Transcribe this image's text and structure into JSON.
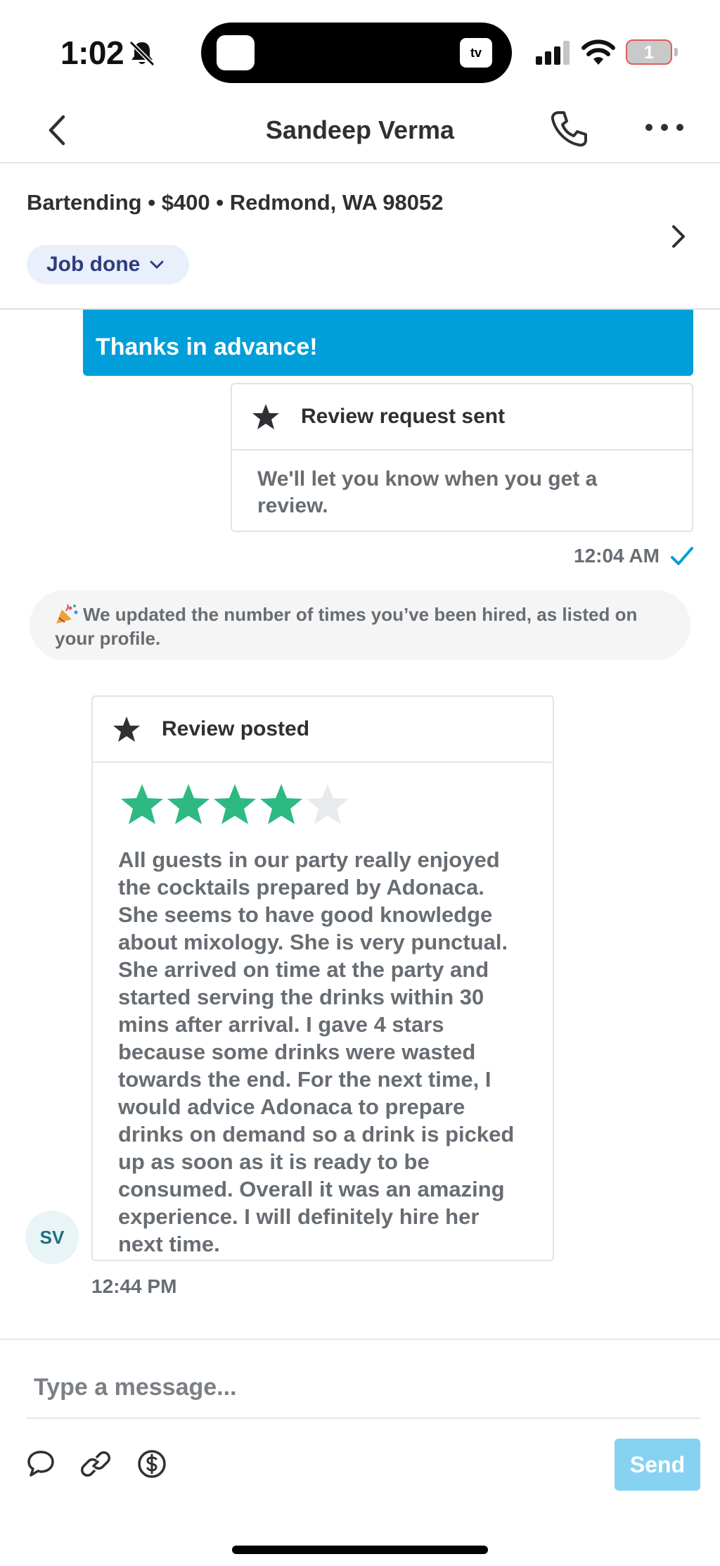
{
  "status_bar": {
    "time": "1:02",
    "island_tv_label": "tv",
    "battery_level": "1"
  },
  "header": {
    "title": "Sandeep Verma"
  },
  "job": {
    "summary": "Bartending • $400 • Redmond, WA 98052",
    "status": "Job done"
  },
  "messages": {
    "bubble_text": "Thanks in advance!",
    "review_request": {
      "title": "Review request sent",
      "body": "We'll let you know when you get a review.",
      "time": "12:04 AM"
    },
    "system_note": "We updated the number of times you’ve been hired, as listed on your profile.",
    "review_posted": {
      "title": "Review posted",
      "rating": 4,
      "max_rating": 5,
      "text": "All guests in our party really enjoyed the cocktails prepared by Adonaca. She seems to have good knowledge about mixology. She is very punctual. She arrived on time at the party and started serving the drinks within 30 mins after arrival. I gave 4 stars because some drinks were wasted towards the end. For the next time, I would advice Adonaca to prepare drinks on demand so a drink is picked up as soon as it is ready to be consumed. Overall it was an amazing experience. I will definitely hire her next time.",
      "time": "12:44 PM"
    },
    "avatar_initials": "SV"
  },
  "composer": {
    "placeholder": "Type a message...",
    "send_label": "Send"
  },
  "colors": {
    "accent_blue": "#009fd9",
    "star_green": "#2db981",
    "star_empty": "#e8eaeb",
    "send_disabled": "#86d3f1"
  }
}
